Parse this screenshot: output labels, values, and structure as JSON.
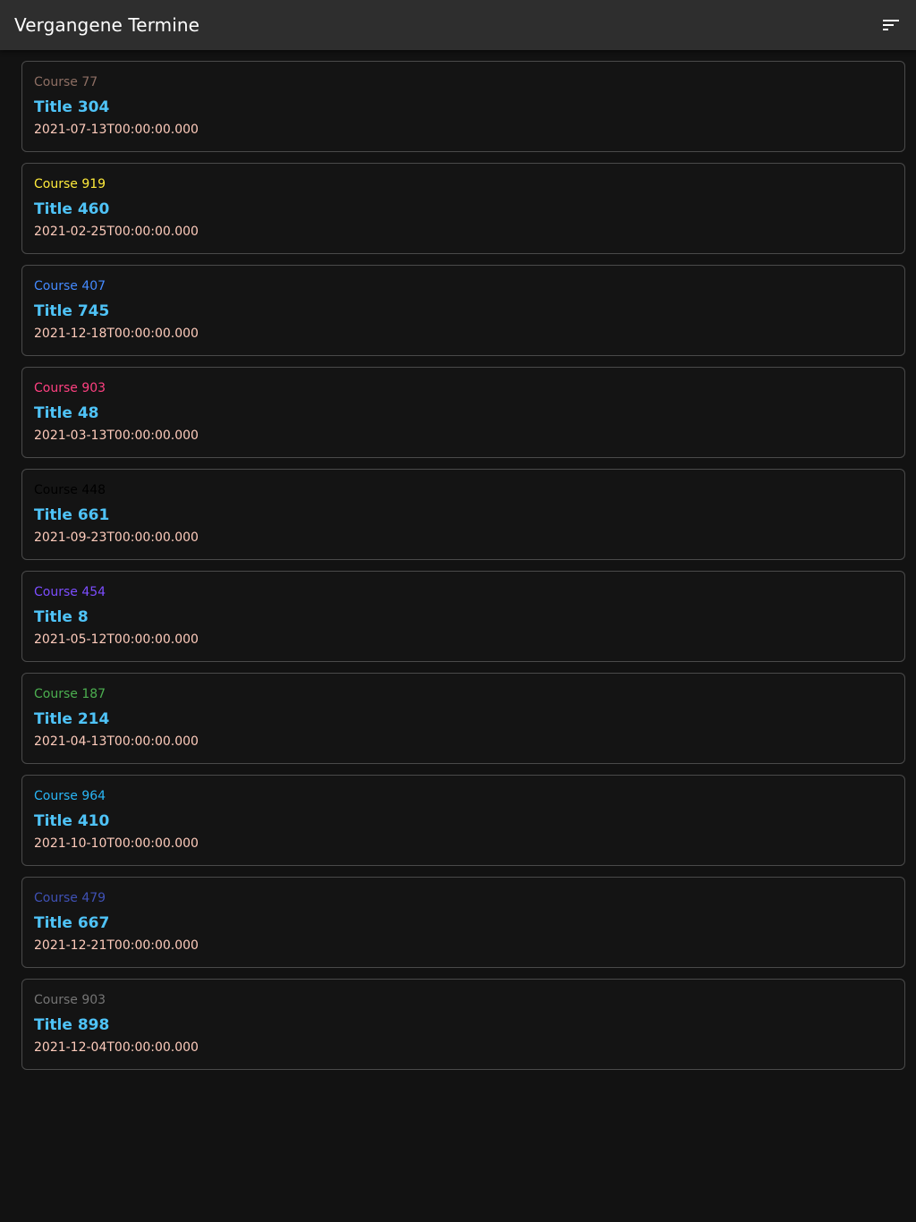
{
  "appbar": {
    "title": "Vergangene Termine",
    "sort_icon": "sort-icon"
  },
  "colors": {
    "title": "#4fc3f7",
    "date": "#ffccbc"
  },
  "appointments": [
    {
      "course": "Course 77",
      "course_color": "#8d6e63",
      "title": "Title 304",
      "date": "2021-07-13T00:00:00.000"
    },
    {
      "course": "Course 919",
      "course_color": "#ffeb3b",
      "title": "Title 460",
      "date": "2021-02-25T00:00:00.000"
    },
    {
      "course": "Course 407",
      "course_color": "#448aff",
      "title": "Title 745",
      "date": "2021-12-18T00:00:00.000"
    },
    {
      "course": "Course 903",
      "course_color": "#ff4081",
      "title": "Title 48",
      "date": "2021-03-13T00:00:00.000"
    },
    {
      "course": "Course 448",
      "course_color": "#000000",
      "title": "Title 661",
      "date": "2021-09-23T00:00:00.000"
    },
    {
      "course": "Course 454",
      "course_color": "#7c4dff",
      "title": "Title 8",
      "date": "2021-05-12T00:00:00.000"
    },
    {
      "course": "Course 187",
      "course_color": "#4caf50",
      "title": "Title 214",
      "date": "2021-04-13T00:00:00.000"
    },
    {
      "course": "Course 964",
      "course_color": "#29b6f6",
      "title": "Title 410",
      "date": "2021-10-10T00:00:00.000"
    },
    {
      "course": "Course 479",
      "course_color": "#3f51b5",
      "title": "Title 667",
      "date": "2021-12-21T00:00:00.000"
    },
    {
      "course": "Course 903",
      "course_color": "#757575",
      "title": "Title 898",
      "date": "2021-12-04T00:00:00.000"
    }
  ]
}
